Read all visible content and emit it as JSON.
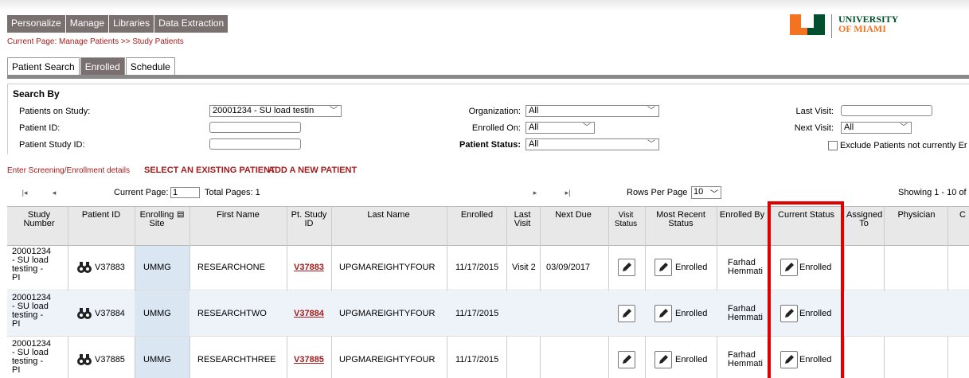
{
  "menu": [
    "Personalize",
    "Manage",
    "Libraries",
    "Data Extraction"
  ],
  "breadcrumb": "Current Page: Manage Patients >> Study Patients",
  "logo": {
    "line1": "UNIVERSITY",
    "line2": "OF MIAMI"
  },
  "tabs": [
    {
      "label": "Patient Search",
      "active": false
    },
    {
      "label": "Enrolled",
      "active": true
    },
    {
      "label": "Schedule",
      "active": false
    }
  ],
  "search": {
    "title": "Search By",
    "patients_on_study_label": "Patients on Study:",
    "patients_on_study_value": "20001234 - SU load testin",
    "patient_id_label": "Patient ID:",
    "patient_study_id_label": "Patient Study ID:",
    "organization_label": "Organization:",
    "organization_value": "All",
    "enrolled_on_label": "Enrolled On:",
    "enrolled_on_value": "All",
    "patient_status_label": "Patient Status:",
    "patient_status_value": "All",
    "last_visit_label": "Last Visit:",
    "next_visit_label": "Next Visit:",
    "next_visit_value": "All",
    "exclude_label": "Exclude Patients not currently Er"
  },
  "actions": {
    "enter_details": "Enter Screening/Enrollment details",
    "select_existing": "SELECT AN EXISTING PATIENT",
    "add_new": "ADD A NEW PATIENT"
  },
  "pager": {
    "current_page_label": "Current Page:",
    "current_page_value": "1",
    "total_pages": "Total Pages: 1",
    "rows_per_page_label": "Rows Per Page",
    "rows_per_page_value": "10",
    "showing": "Showing 1 - 10 of"
  },
  "columns": {
    "study_number": "Study Number",
    "patient_id": "Patient ID",
    "enrolling_site": "Enrolling Site",
    "first_name": "First Name",
    "pt_study_id": "Pt. Study ID",
    "last_name": "Last Name",
    "enrolled": "Enrolled",
    "last_visit": "Last Visit",
    "next_due": "Next Due",
    "visit_status": "Visit Status",
    "most_recent_status": "Most Recent Status",
    "enrolled_by": "Enrolled By",
    "current_status": "Current Status",
    "assigned_to": "Assigned To",
    "physician": "Physician",
    "cut": "C"
  },
  "rows": [
    {
      "study": "20001234 - SU load testing - PI",
      "patient_id": "V37883",
      "site": "UMMG",
      "first": "RESEARCHONE",
      "pt_study_id": "V37883",
      "last": "UPGMAREIGHTYFOUR",
      "enrolled": "11/17/2015",
      "last_visit": "Visit 2",
      "next_due": "03/09/2017",
      "recent": "Enrolled",
      "enrolled_by": "Farhad Hemmati",
      "current": "Enrolled"
    },
    {
      "study": "20001234 - SU load testing - PI",
      "patient_id": "V37884",
      "site": "UMMG",
      "first": "RESEARCHTWO",
      "pt_study_id": "V37884",
      "last": "UPGMAREIGHTYFOUR",
      "enrolled": "11/17/2015",
      "last_visit": "",
      "next_due": "",
      "recent": "Enrolled",
      "enrolled_by": "Farhad Hemmati",
      "current": "Enrolled"
    },
    {
      "study": "20001234 - SU load testing - PI",
      "patient_id": "V37885",
      "site": "UMMG",
      "first": "RESEARCHTHREE",
      "pt_study_id": "V37885",
      "last": "UPGMAREIGHTYFOUR",
      "enrolled": "11/17/2015",
      "last_visit": "",
      "next_due": "",
      "recent": "Enrolled",
      "enrolled_by": "Farhad Hemmati",
      "current": "Enrolled"
    }
  ]
}
